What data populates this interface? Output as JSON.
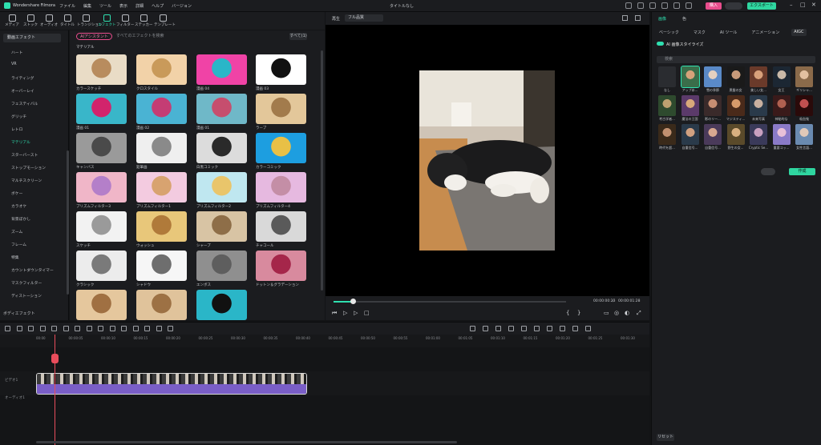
{
  "titlebar": {
    "app_name": "Wondershare Filmora",
    "menu": [
      "ファイル",
      "編集",
      "ツール",
      "表示",
      "詳細",
      "ヘルプ",
      "バージョン"
    ],
    "doc_title": "タイトルなし",
    "buy_label": "購入",
    "export_label": "エクスポート"
  },
  "toolbar": {
    "tools": [
      "メディア",
      "ストック",
      "オーディオ",
      "タイトル",
      "トランジション",
      "エフェクト",
      "フィルター",
      "ステッカー",
      "テンプレート"
    ],
    "active": "エフェクト"
  },
  "categories": {
    "header": "動画エフェクト",
    "items": [
      "ハート",
      "VR",
      "ライティング",
      "オーバーレイ",
      "フェスティバル",
      "グリッチ",
      "レトロ",
      "マテリアル",
      "スターバースト",
      "ストップモーション",
      "マルチスクリーン",
      "ボケー",
      "カラオケ",
      "背景ぼかし",
      "ズーム",
      "フレーム",
      "特集",
      "カウントダウンタイマー",
      "マスクフィルター",
      "ディストーション"
    ],
    "active": "マテリアル",
    "footer": "ボディエフェクト"
  },
  "effects": {
    "assistant_label": "AIアシスタント",
    "search_placeholder": "すべてのエフェクトを検索",
    "all_label": "すべて(1)",
    "section_title": "マテリアル",
    "items": [
      {
        "label": "カラースケッチ",
        "c1": "#e9dcc6",
        "c2": "#b88c5e"
      },
      {
        "label": "クロスタイル",
        "c1": "#f2d2a8",
        "c2": "#c99a5a"
      },
      {
        "label": "漫画 04",
        "c1": "#f043a6",
        "c2": "#2ab6c8"
      },
      {
        "label": "漫画 03",
        "c1": "#ffffff",
        "c2": "#111111"
      },
      {
        "label": "漫画 01",
        "c1": "#39b6c9",
        "c2": "#d2246c"
      },
      {
        "label": "漫画 02",
        "c1": "#4ab3d3",
        "c2": "#c43d74"
      },
      {
        "label": "漫画 01",
        "c1": "#6fb8c8",
        "c2": "#c64e6e"
      },
      {
        "label": "ラーブ",
        "c1": "#e3c79a",
        "c2": "#a27b4c"
      },
      {
        "label": "キャンバス",
        "c1": "#9a9a9a",
        "c2": "#4a4a4a"
      },
      {
        "label": "鉛筆画",
        "c1": "#efefef",
        "c2": "#8a8a8a"
      },
      {
        "label": "白黒コミック",
        "c1": "#dcdcdc",
        "c2": "#2a2a2a"
      },
      {
        "label": "カラーコミック",
        "c1": "#1d9ee0",
        "c2": "#e8c046"
      },
      {
        "label": "プリズムフィルター3",
        "c1": "#f0b6c8",
        "c2": "#b47fc9"
      },
      {
        "label": "プリズムフィルター1",
        "c1": "#f3cbe0",
        "c2": "#d8a370"
      },
      {
        "label": "プリズムフィルター2",
        "c1": "#bfe7f0",
        "c2": "#e9c56b"
      },
      {
        "label": "プリズムフィルター4",
        "c1": "#e6b9e0",
        "c2": "#c48ea6"
      },
      {
        "label": "スケッチ",
        "c1": "#f2f2f2",
        "c2": "#9a9a9a"
      },
      {
        "label": "ウォッシュ",
        "c1": "#e8c77a",
        "c2": "#b07a3a"
      },
      {
        "label": "シャープ",
        "c1": "#d8c4a4",
        "c2": "#8e6e48"
      },
      {
        "label": "チャコール",
        "c1": "#d9d9d9",
        "c2": "#5a5a5a"
      },
      {
        "label": "クラシック",
        "c1": "#ececec",
        "c2": "#7a7a7a"
      },
      {
        "label": "シャドウ",
        "c1": "#f6f6f6",
        "c2": "#6e6e6e"
      },
      {
        "label": "エンボス",
        "c1": "#8f8f8f",
        "c2": "#5e5e5e"
      },
      {
        "label": "ドットン＆グラデーション",
        "c1": "#d88a9e",
        "c2": "#a5264a"
      },
      {
        "label": "",
        "c1": "#e5c79d",
        "c2": "#a07042"
      },
      {
        "label": "",
        "c1": "#e0c39b",
        "c2": "#9d7144"
      },
      {
        "label": "",
        "c1": "#2ab6c8",
        "c2": "#111111"
      }
    ]
  },
  "preview": {
    "label": "再生",
    "quality": "フル品質",
    "timecode_current": "00:00:00:23",
    "timecode_total": "00:00:01:28"
  },
  "rightpanel": {
    "tabs": [
      "画像",
      "色"
    ],
    "active_tab": "画像",
    "subtabs": [
      "ベーシック",
      "マスク",
      "AI ツール",
      "アニメーション",
      "AIGC"
    ],
    "active_subtab": "AIGC",
    "ai_toggle_label": "AI 画像スタイライズ",
    "search_placeholder": "検索",
    "styles": [
      {
        "label": "なし",
        "c1": "#2a2c30",
        "c2": "#2a2c30"
      },
      {
        "label": "アップ氷...",
        "c1": "#3a6d4a",
        "c2": "#d7a27a"
      },
      {
        "label": "雪の季節",
        "c1": "#5a8ac8",
        "c2": "#e3d0c0"
      },
      {
        "label": "黒髪の女",
        "c1": "#1a1a1a",
        "c2": "#c79a7a"
      },
      {
        "label": "美しい女...",
        "c1": "#6a3a2a",
        "c2": "#d8a07a"
      },
      {
        "label": "女王",
        "c1": "#1c2733",
        "c2": "#c9b9a8"
      },
      {
        "label": "ギリシャ...",
        "c1": "#8a6a4a",
        "c2": "#e2c0a0"
      },
      {
        "label": "考古学者...",
        "c1": "#2e4a2e",
        "c2": "#bca070"
      },
      {
        "label": "魔法の王国",
        "c1": "#5b3a6a",
        "c2": "#d8a87a"
      },
      {
        "label": "影のリー...",
        "c1": "#3a2a2a",
        "c2": "#c88e72"
      },
      {
        "label": "マジスティ...",
        "c1": "#4a2a1a",
        "c2": "#d89a6a"
      },
      {
        "label": "未来写真",
        "c1": "#2a3a4a",
        "c2": "#c8b0a0"
      },
      {
        "label": "神秘的な",
        "c1": "#3a1a1a",
        "c2": "#b06050"
      },
      {
        "label": "吸血鬼",
        "c1": "#2a0a0a",
        "c2": "#c05050"
      },
      {
        "label": "時代を超...",
        "c1": "#3a2a1a",
        "c2": "#c09070"
      },
      {
        "label": "自重信号...",
        "c1": "#2a3a4a",
        "c2": "#d0a080"
      },
      {
        "label": "自重信号...",
        "c1": "#4a3a5a",
        "c2": "#d8a890"
      },
      {
        "label": "野生の女...",
        "c1": "#5a4a2a",
        "c2": "#d8b080"
      },
      {
        "label": "Cryptic Se...",
        "c1": "#3a3a5a",
        "c2": "#c8a0c0"
      },
      {
        "label": "重要コッ...",
        "c1": "#8a7ac8",
        "c2": "#e8c0d8"
      },
      {
        "label": "女性言語...",
        "c1": "#6a8ab0",
        "c2": "#e0c8b8"
      }
    ],
    "apply_label": "作成",
    "reset_label": "リセット"
  },
  "timeline": {
    "ticks": [
      "00:00",
      "00:00:05",
      "00:00:10",
      "00:00:15",
      "00:00:20",
      "00:00:25",
      "00:00:30",
      "00:00:35",
      "00:00:40",
      "00:00:45",
      "00:00:50",
      "00:00:55",
      "00:01:00",
      "00:01:05",
      "00:01:10",
      "00:01:15",
      "00:01:20",
      "00:01:25",
      "00:01:30"
    ],
    "track_video_label": "ビデオ1",
    "track_audio_label": "オーディオ1"
  }
}
